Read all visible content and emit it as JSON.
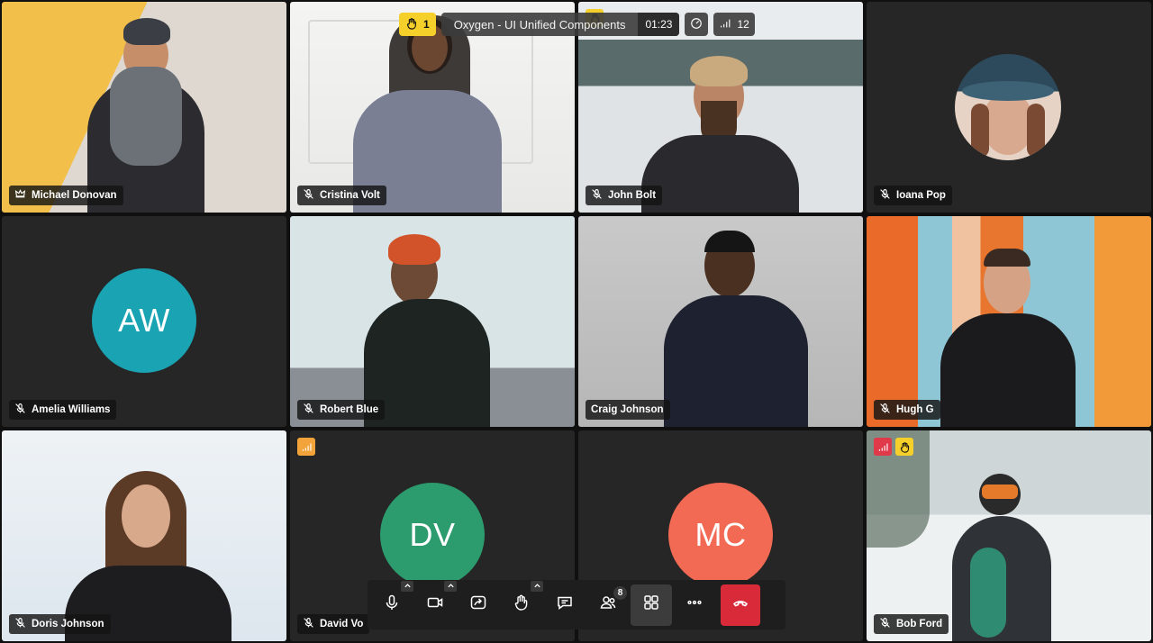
{
  "header": {
    "raised_hands_count": "1",
    "meeting_title": "Oxygen - UI Unified Components",
    "timer": "01:23",
    "participants_count": "12"
  },
  "participants": [
    {
      "name": "Michael Donovan",
      "role": "host"
    },
    {
      "name": "Cristina Volt",
      "muted": true
    },
    {
      "name": "John Bolt",
      "muted": true,
      "speaking": true
    },
    {
      "name": "Ioana Pop",
      "muted": true
    },
    {
      "name": "Amelia Williams",
      "initials": "AW",
      "avatar_color": "#1aa3b3",
      "muted": true
    },
    {
      "name": "Robert Blue",
      "muted": true
    },
    {
      "name": "Craig Johnson",
      "pinned": true
    },
    {
      "name": "Hugh G",
      "muted": true
    },
    {
      "name": "Doris Johnson",
      "muted": true
    },
    {
      "name": "David Vo",
      "initials": "DV",
      "avatar_color": "#2c9b6d",
      "muted": true
    },
    {
      "name": "",
      "initials": "MC",
      "avatar_color": "#f26a54"
    },
    {
      "name": "Bob Ford",
      "muted": true
    }
  ],
  "toolbar": {
    "people_badge": "8",
    "buttons": [
      "microphone",
      "camera",
      "share-screen",
      "raise-hand",
      "chat",
      "participants",
      "layout",
      "more",
      "hang-up"
    ]
  },
  "colors": {
    "accent_yellow": "#f5cf2a",
    "active_blue": "#2f6fe0",
    "hangup_red": "#d92a3a",
    "poor_connection_red": "#e03a4a",
    "weak_connection_orange": "#f2a33a"
  }
}
